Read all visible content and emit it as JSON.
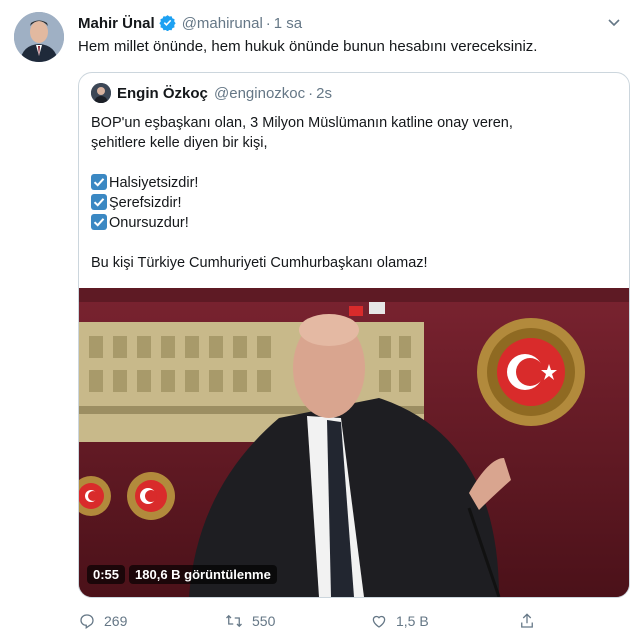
{
  "tweet": {
    "author_name": "Mahir Ünal",
    "author_handle": "@mahirunal",
    "separator": "·",
    "time": "1 sa",
    "text": "Hem millet önünde, hem hukuk önünde bunun hesabını vereceksiniz."
  },
  "quote": {
    "author_name": "Engin Özkoç",
    "author_handle": "@enginozkoc",
    "separator": "·",
    "time": "2s",
    "line1": "BOP'un eşbaşkanı olan, 3 Milyon Müslümanın katline onay veren,",
    "line2": "şehitlere kelle diyen bir kişi,",
    "check1": "Halsiyetsizdir!",
    "check2": "Şerefsizdir!",
    "check3": "Onursuzdur!",
    "line3": "Bu kişi Türkiye Cumhuriyeti Cumhurbaşkanı olamaz!",
    "video": {
      "duration": "0:55",
      "views": "180,6 B görüntülenme"
    }
  },
  "actions": {
    "replies": "269",
    "retweets": "550",
    "likes": "1,5 B"
  },
  "colors": {
    "text_primary": "#14171a",
    "text_secondary": "#657786",
    "verified": "#1da1f2",
    "check": "#3b88c3",
    "border": "#ccd6dd"
  }
}
